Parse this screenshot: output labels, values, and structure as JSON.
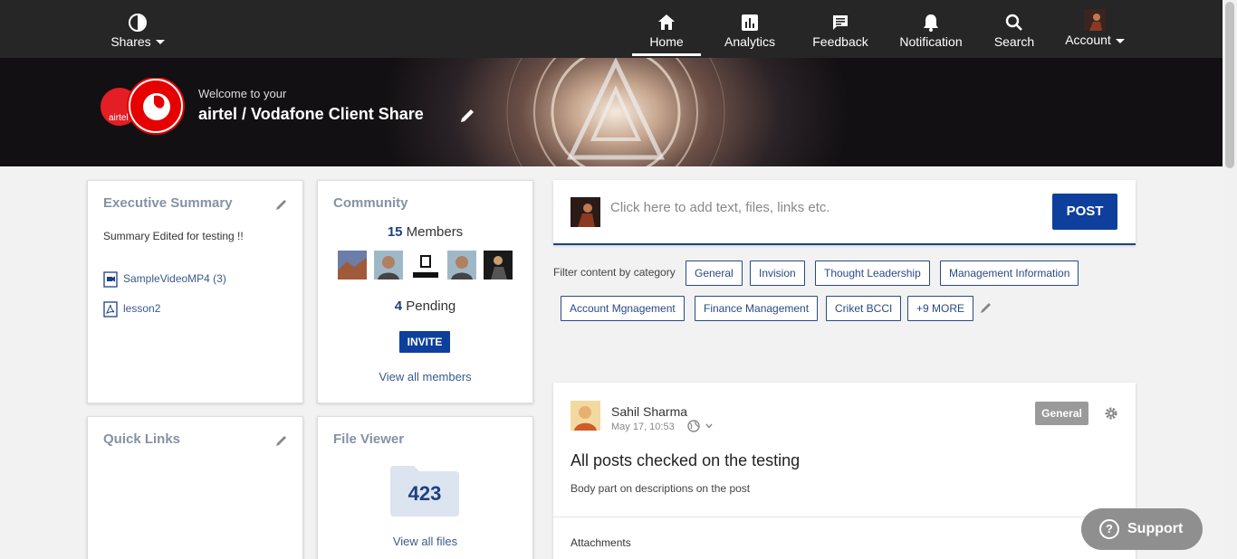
{
  "topnav": {
    "shares_label": "Shares",
    "items": [
      {
        "label": "Home",
        "icon": "home-icon",
        "active": true
      },
      {
        "label": "Analytics",
        "icon": "analytics-icon"
      },
      {
        "label": "Feedback",
        "icon": "feedback-icon"
      },
      {
        "label": "Notification",
        "icon": "bell-icon"
      },
      {
        "label": "Search",
        "icon": "search-icon"
      },
      {
        "label": "Account",
        "icon": "user-avatar"
      }
    ]
  },
  "banner": {
    "welcome_small": "Welcome to your",
    "welcome_title": "airtel / Vodafone Client Share",
    "logo_text": "airtel"
  },
  "executive_summary": {
    "title": "Executive Summary",
    "text": "Summary Edited for testing !!",
    "files": [
      {
        "name": "SampleVideoMP4 (3)",
        "icon": "video-file-icon"
      },
      {
        "name": "lesson2",
        "icon": "pdf-file-icon"
      }
    ]
  },
  "community": {
    "title": "Community",
    "members_count": "15",
    "members_label": "Members",
    "pending_count": "4",
    "pending_label": "Pending",
    "invite_label": "INVITE",
    "view_all_label": "View all members"
  },
  "quick_links": {
    "title": "Quick Links"
  },
  "file_viewer": {
    "title": "File Viewer",
    "count": "423",
    "view_all_label": "View all files"
  },
  "composer": {
    "placeholder": "Click here to add text, files, links etc.",
    "post_label": "POST"
  },
  "filter": {
    "label": "Filter content by category",
    "categories": [
      "General",
      "Invision",
      "Thought Leadership",
      "Management Information",
      "Account Mgnagement",
      "Finance Management",
      "Criket BCCI",
      "+9 MORE"
    ]
  },
  "post": {
    "author": "Sahil Sharma",
    "time": "May 17, 10:53",
    "category": "General",
    "title": "All posts checked on the testing",
    "body": "Body part on descriptions on the post",
    "attachments_label": "Attachments"
  },
  "support": {
    "label": "Support"
  },
  "colors": {
    "brand": "#0e3f9c",
    "nav_bg": "#262626",
    "notification_dot": "#e53945"
  }
}
